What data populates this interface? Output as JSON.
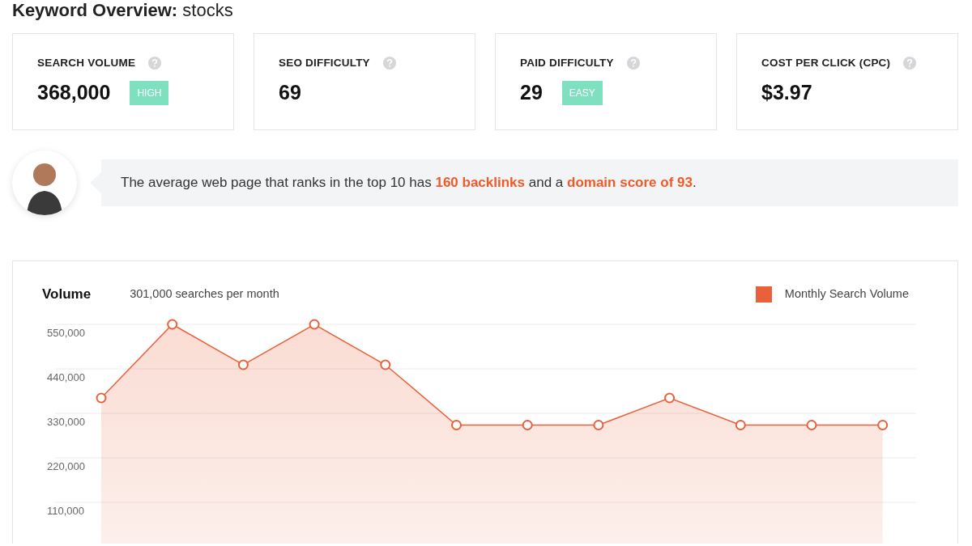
{
  "page_title": {
    "label": "Keyword Overview:",
    "keyword": "stocks"
  },
  "metrics": [
    {
      "label": "SEARCH VOLUME",
      "value": "368,000",
      "badge": "HIGH"
    },
    {
      "label": "SEO DIFFICULTY",
      "value": "69"
    },
    {
      "label": "PAID DIFFICULTY",
      "value": "29",
      "badge": "EASY"
    },
    {
      "label": "COST PER CLICK (CPC)",
      "value": "$3.97"
    }
  ],
  "insight": {
    "text": "The average web page that ranks in the top 10 has **160 backlinks** and a **domain score of 93**."
  },
  "volume_panel": {
    "title": "Volume",
    "subtitle": "301,000 searches per month",
    "chart_data": {
      "type": "area",
      "grid": true,
      "ylim": [
        0,
        550000
      ],
      "yticks": [
        {
          "value": 110000,
          "label": "110,000"
        },
        {
          "value": 220000,
          "label": "220,000"
        },
        {
          "value": 330000,
          "label": "330,000"
        },
        {
          "value": 440000,
          "label": "440,000"
        },
        {
          "value": 550000,
          "label": "550,000"
        }
      ],
      "series": [
        {
          "name": "Monthly Search Volume",
          "color": "#e8613a",
          "values": [
            368000,
            550000,
            450000,
            550000,
            450000,
            301000,
            301000,
            301000,
            368000,
            301000,
            301000,
            301000
          ]
        }
      ]
    }
  }
}
